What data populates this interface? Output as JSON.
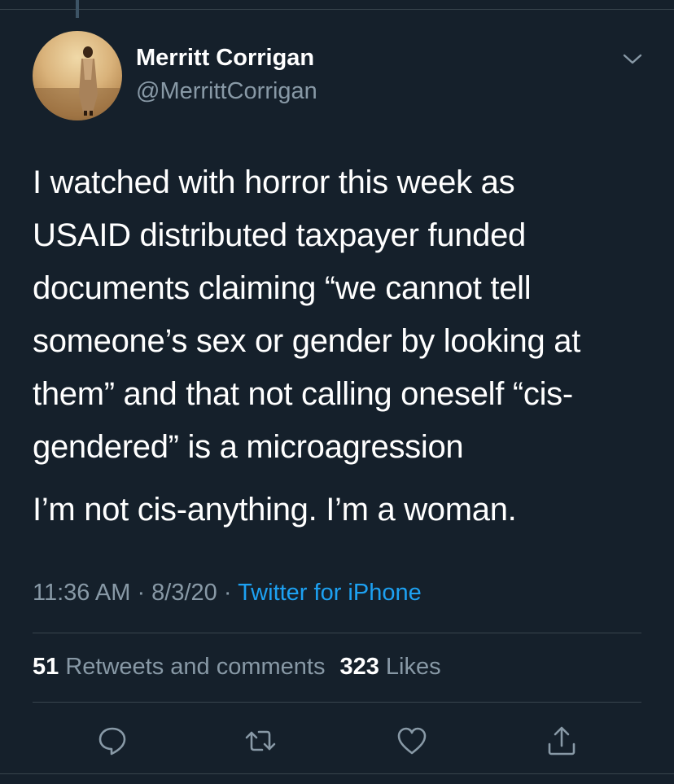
{
  "author": {
    "name": "Merritt Corrigan",
    "handle": "@MerrittCorrigan"
  },
  "icons": {
    "menu": "chevron-down-icon",
    "reply": "reply-icon",
    "retweet": "retweet-icon",
    "like": "heart-icon",
    "share": "share-icon"
  },
  "tweet": {
    "text_1": "I watched with horror this week as\nUSAID distributed taxpayer funded\ndocuments claiming “we cannot tell\nsomeone’s sex or gender by looking at\nthem” and that not calling oneself “cis-\ngendered” is a microagression",
    "text_2": "I’m not cis-anything. I’m a woman."
  },
  "meta": {
    "time": "11:36 AM",
    "separator": " · ",
    "date": "8/3/20",
    "source": "Twitter for iPhone"
  },
  "stats": {
    "retweets_count": "51",
    "retweets_label": " Retweets and comments",
    "likes_count": "323",
    "likes_label": " Likes"
  },
  "colors": {
    "background": "#15202b",
    "secondary_text": "#8899a6",
    "link": "#1da1f2",
    "divider": "#38444d"
  }
}
